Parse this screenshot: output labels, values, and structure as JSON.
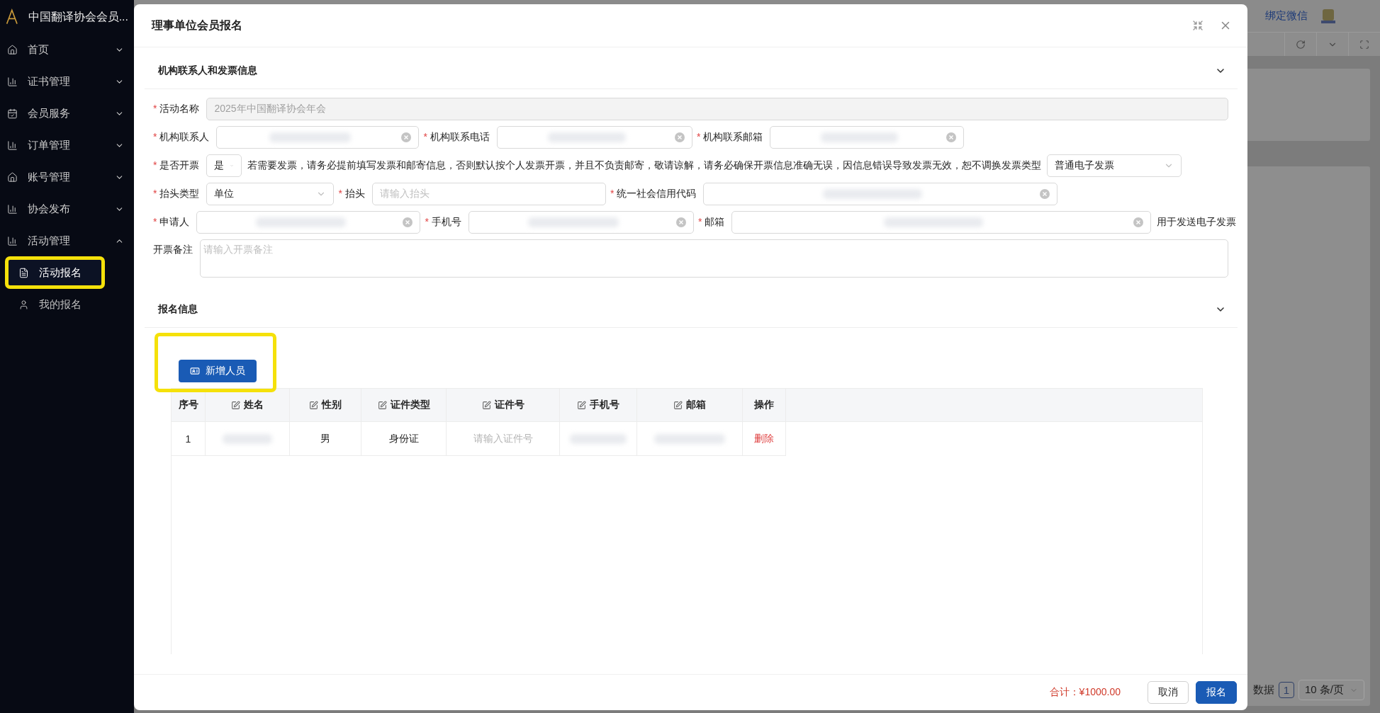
{
  "sidebar": {
    "title": "中国翻译协会会员...",
    "items": [
      {
        "label": "首页",
        "kind": "home",
        "expanded": false
      },
      {
        "label": "证书管理",
        "kind": "chart",
        "expanded": false
      },
      {
        "label": "会员服务",
        "kind": "calendar",
        "expanded": false
      },
      {
        "label": "订单管理",
        "kind": "chart",
        "expanded": false
      },
      {
        "label": "账号管理",
        "kind": "home",
        "expanded": false
      },
      {
        "label": "协会发布",
        "kind": "chart",
        "expanded": false
      },
      {
        "label": "活动管理",
        "kind": "chart",
        "expanded": true,
        "children": [
          {
            "label": "活动报名",
            "kind": "form",
            "selected": true,
            "highlighted": true
          },
          {
            "label": "我的报名",
            "kind": "user",
            "selected": false,
            "highlighted": false
          }
        ]
      }
    ]
  },
  "header": {
    "link": "绑定微信"
  },
  "pagination": {
    "summary": "数据",
    "page": "1",
    "page_size": "10 条/页"
  },
  "modal": {
    "title": "理事单位会员报名",
    "sections": [
      {
        "title": "机构联系人和发票信息",
        "expanded": true,
        "kind": "form",
        "rows": [
          [
            {
              "kind": "input",
              "marker": "*",
              "label": "活动名称",
              "value": "2025年中国翻译协会年会",
              "disabled": true
            }
          ],
          [
            {
              "kind": "input",
              "marker": "*",
              "label": "机构联系人",
              "redacted": true,
              "clearable": true
            },
            {
              "kind": "input",
              "marker": "*",
              "label": "机构联系电话",
              "redacted": true,
              "clearable": true
            },
            {
              "kind": "input",
              "marker": "*",
              "label": "机构联系邮箱",
              "redacted": true,
              "clearable": true
            }
          ],
          [
            {
              "kind": "select",
              "marker": "*",
              "label": "是否开票",
              "value": "是"
            },
            {
              "kind": "note",
              "text": "若需要发票，请务必提前填写发票和邮寄信息，否则默认按个人发票开票，并且不负责邮寄，敬请谅解，请务必确保开票信息准确无误，因信息错误导致发票无效，恕不调换发票类型"
            },
            {
              "kind": "select",
              "value": "普通电子发票"
            }
          ],
          [
            {
              "kind": "select",
              "marker": "*",
              "label": "抬头类型",
              "value": "单位"
            },
            {
              "kind": "input",
              "marker": "*",
              "label": "抬头",
              "placeholder": "请输入抬头"
            },
            {
              "kind": "input",
              "marker": "*",
              "label": "统一社会信用代码",
              "redacted": true,
              "clearable": true
            }
          ],
          [
            {
              "kind": "input",
              "marker": "*",
              "label": "申请人",
              "redacted": true,
              "clearable": true
            },
            {
              "kind": "input",
              "marker": "*",
              "label": "手机号",
              "redacted": true,
              "clearable": true
            },
            {
              "kind": "input",
              "marker": "*",
              "label": "邮箱",
              "redacted": true,
              "clearable": true
            },
            {
              "kind": "note",
              "text": "用于发送电子发票"
            }
          ],
          [
            {
              "kind": "textarea",
              "label": "开票备注",
              "placeholder": "请输入开票备注"
            }
          ]
        ]
      },
      {
        "title": "报名信息",
        "expanded": true,
        "kind": "table",
        "add_button": {
          "label": "新增人员",
          "highlighted": true
        },
        "columns": [
          {
            "label": "序号",
            "editable": false
          },
          {
            "label": "姓名",
            "editable": true
          },
          {
            "label": "性别",
            "editable": true
          },
          {
            "label": "证件类型",
            "editable": true
          },
          {
            "label": "证件号",
            "editable": true
          },
          {
            "label": "手机号",
            "editable": true
          },
          {
            "label": "邮箱",
            "editable": true
          },
          {
            "label": "操作",
            "editable": false
          }
        ],
        "rows": [
          {
            "cells": [
              {
                "kind": "text",
                "text": "1"
              },
              {
                "kind": "redacted"
              },
              {
                "kind": "text",
                "text": "男"
              },
              {
                "kind": "text",
                "text": "身份证"
              },
              {
                "kind": "placeholder",
                "text": "请输入证件号"
              },
              {
                "kind": "redacted"
              },
              {
                "kind": "redacted"
              },
              {
                "kind": "action",
                "text": "删除"
              }
            ]
          }
        ]
      }
    ],
    "footer": {
      "total": "合计：¥1000.00",
      "buttons": [
        {
          "label": "取消",
          "kind": "default"
        },
        {
          "label": "报名",
          "kind": "primary"
        }
      ]
    }
  }
}
